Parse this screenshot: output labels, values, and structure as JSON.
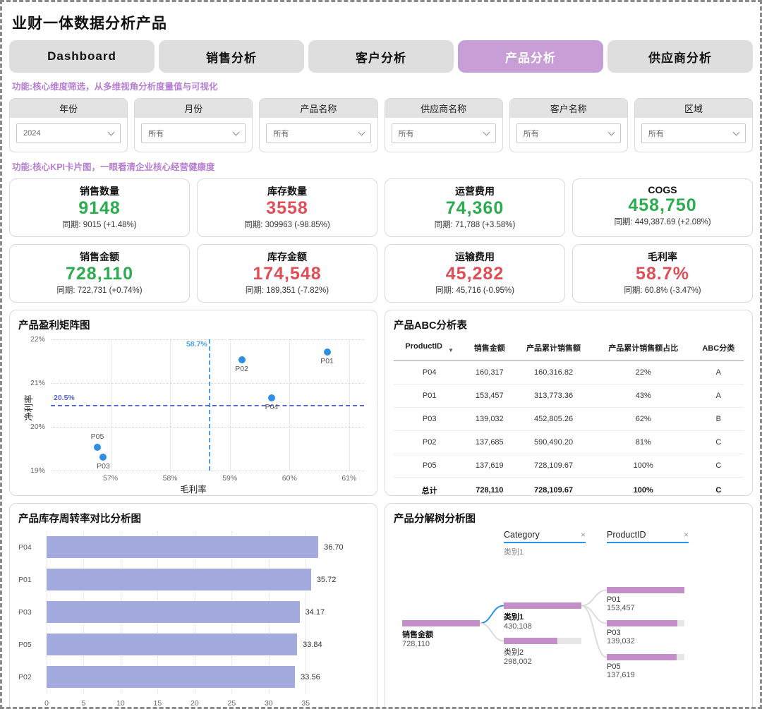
{
  "title": "业财一体数据分析产品",
  "tabs": [
    "Dashboard",
    "销售分析",
    "客户分析",
    "产品分析",
    "供应商分析"
  ],
  "active_tab": "产品分析",
  "notes": {
    "filter_note": "功能:核心维度筛选，从多维视角分析度量值与可视化",
    "kpi_note": "功能:核心KPI卡片图，一眼看清企业核心经营健康度"
  },
  "filters": [
    {
      "label": "年份",
      "value": "2024"
    },
    {
      "label": "月份",
      "value": "所有"
    },
    {
      "label": "产品名称",
      "value": "所有"
    },
    {
      "label": "供应商名称",
      "value": "所有"
    },
    {
      "label": "客户名称",
      "value": "所有"
    },
    {
      "label": "区域",
      "value": "所有"
    }
  ],
  "kpis": [
    {
      "title": "销售数量",
      "value": "9148",
      "trend": "green",
      "sub": "同期: 9015 (+1.48%)"
    },
    {
      "title": "库存数量",
      "value": "3558",
      "trend": "red",
      "sub": "同期: 309963 (-98.85%)"
    },
    {
      "title": "运营费用",
      "value": "74,360",
      "trend": "green",
      "sub": "同期: 71,788 (+3.58%)"
    },
    {
      "title": "COGS",
      "value": "458,750",
      "trend": "green",
      "sub": "同期: 449,387.69 (+2.08%)"
    },
    {
      "title": "销售金额",
      "value": "728,110",
      "trend": "green",
      "sub": "同期: 722,731 (+0.74%)"
    },
    {
      "title": "库存金额",
      "value": "174,548",
      "trend": "red",
      "sub": "同期: 189,351 (-7.82%)"
    },
    {
      "title": "运输费用",
      "value": "45,282",
      "trend": "red",
      "sub": "同期: 45,716 (-0.95%)"
    },
    {
      "title": "毛利率",
      "value": "58.7%",
      "trend": "red",
      "sub": "同期: 60.8% (-3.47%)"
    }
  ],
  "colors": {
    "accent_purple": "#c79fd6",
    "note_purple": "#b77fd2",
    "kpi_green": "#2bac4f",
    "kpi_red": "#e04f58",
    "scatter_point_blue": "#2e8de4",
    "refline_blue": "#49a0e8",
    "refline_indigo": "#5768d0",
    "bar_periwinkle": "#a3aade",
    "tree_bar_mauve": "#c48fc9"
  },
  "chart_data": {
    "scatter": {
      "type": "scatter",
      "title": "产品盈利矩阵图",
      "xlabel": "毛利率",
      "ylabel": "净利率",
      "xlim": [
        56,
        61.25
      ],
      "ylim": [
        19,
        22
      ],
      "x_ticks": [
        {
          "v": 57,
          "label": "57%"
        },
        {
          "v": 58,
          "label": "58%"
        },
        {
          "v": 59,
          "label": "59%"
        },
        {
          "v": 60,
          "label": "60%"
        },
        {
          "v": 61,
          "label": "61%"
        }
      ],
      "y_ticks": [
        {
          "v": 19,
          "label": "19%"
        },
        {
          "v": 20,
          "label": "20%"
        },
        {
          "v": 21,
          "label": "21%"
        },
        {
          "v": 22,
          "label": "22%"
        }
      ],
      "points": [
        {
          "id": "P01",
          "x": 60.63,
          "y": 21.7,
          "label_pos": "below"
        },
        {
          "id": "P02",
          "x": 59.2,
          "y": 21.52,
          "label_pos": "below"
        },
        {
          "id": "P04",
          "x": 59.7,
          "y": 20.65,
          "label_pos": "below"
        },
        {
          "id": "P05",
          "x": 56.78,
          "y": 19.52,
          "label_pos": "above"
        },
        {
          "id": "P03",
          "x": 56.88,
          "y": 19.3,
          "label_pos": "below"
        }
      ],
      "ref_lines": [
        {
          "orientation": "vertical",
          "value": 58.65,
          "label": "58.7%"
        },
        {
          "orientation": "horizontal",
          "value": 20.5,
          "label": "20.5%"
        }
      ],
      "grid": true
    },
    "abc_table": {
      "type": "table",
      "title": "产品ABC分析表",
      "columns": [
        "ProductID",
        "销售金额",
        "产品累计销售额",
        "产品累计销售额占比",
        "ABC分类"
      ],
      "sorted_column": "ProductID",
      "rows": [
        [
          "P04",
          "160,317",
          "160,316.82",
          "22%",
          "A"
        ],
        [
          "P01",
          "153,457",
          "313,773.36",
          "43%",
          "A"
        ],
        [
          "P03",
          "139,032",
          "452,805.26",
          "62%",
          "B"
        ],
        [
          "P02",
          "137,685",
          "590,490.20",
          "81%",
          "C"
        ],
        [
          "P05",
          "137,619",
          "728,109.67",
          "100%",
          "C"
        ]
      ],
      "total_row": [
        "总计",
        "728,110",
        "728,109.67",
        "100%",
        "C"
      ]
    },
    "turnover_bar": {
      "type": "bar",
      "orientation": "horizontal",
      "title": "产品库存周转率对比分析图",
      "categories": [
        "P04",
        "P01",
        "P03",
        "P05",
        "P02"
      ],
      "values": [
        36.7,
        35.72,
        34.17,
        33.84,
        33.56
      ],
      "value_labels": [
        "36.70",
        "35.72",
        "34.17",
        "33.84",
        "33.56"
      ],
      "xlim": [
        0,
        38.5
      ],
      "x_ticks": [
        0,
        5,
        10,
        15,
        20,
        25,
        30,
        35
      ],
      "grid": true
    },
    "decomp_tree": {
      "type": "tree",
      "title": "产品分解树分析图",
      "level_headers": [
        {
          "label": "Category",
          "selected": "类别1"
        },
        {
          "label": "ProductID",
          "selected": ""
        }
      ],
      "root": {
        "label": "销售金额",
        "value": "728,110",
        "fill": 1
      },
      "children": [
        {
          "label": "类别1",
          "value": "430,108",
          "fill": 1,
          "selected": true
        },
        {
          "label": "类别2",
          "value": "298,002",
          "fill": 0.69,
          "selected": false
        }
      ],
      "grandchildren": [
        {
          "label": "P01",
          "value": "153,457",
          "fill": 1
        },
        {
          "label": "P03",
          "value": "139,032",
          "fill": 0.91
        },
        {
          "label": "P05",
          "value": "137,619",
          "fill": 0.9
        }
      ]
    }
  }
}
